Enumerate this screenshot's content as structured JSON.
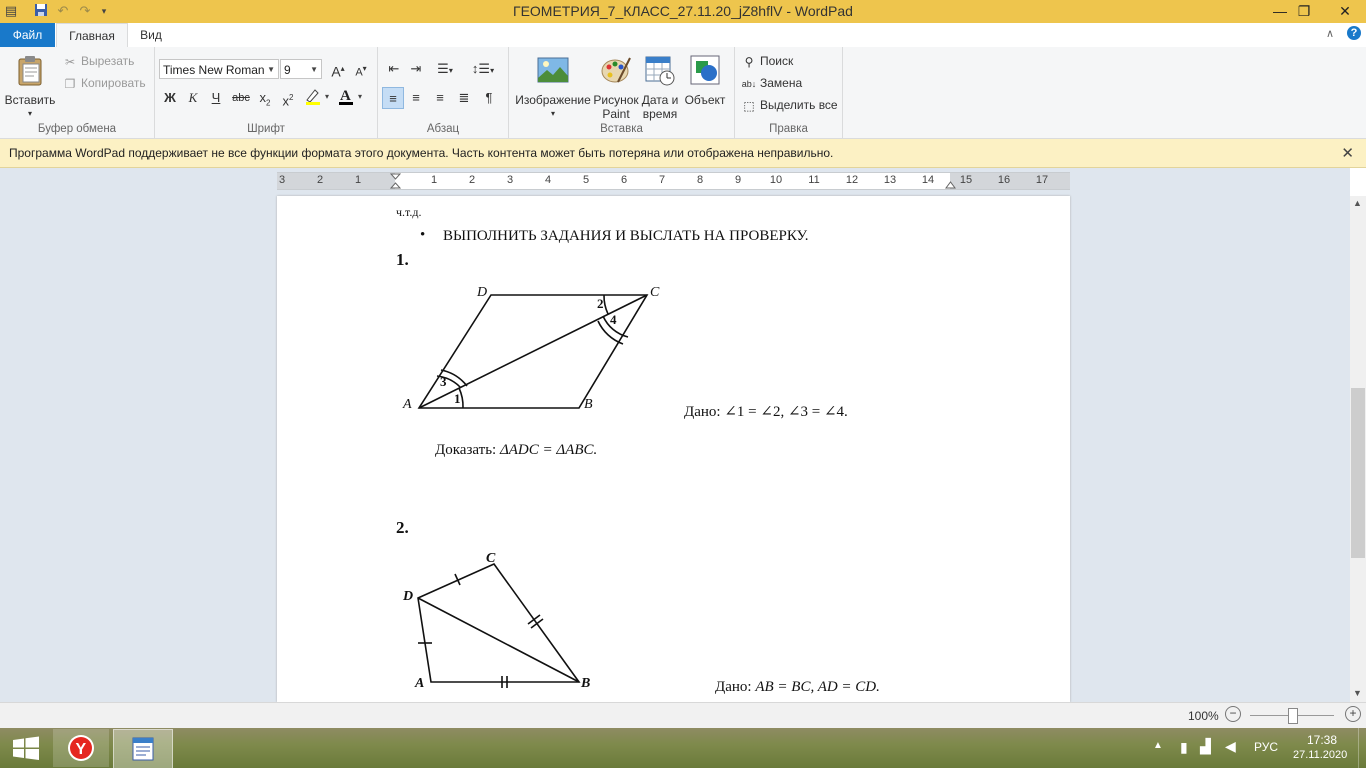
{
  "window": {
    "title": "ГЕОМЕТРИЯ_7_КЛАСС_27.11.20_jZ8hflV - WordPad"
  },
  "menu": {
    "file": "Файл",
    "tabs": [
      "Главная",
      "Вид"
    ]
  },
  "ribbon": {
    "clipboard": {
      "paste": "Вставить",
      "cut": "Вырезать",
      "copy": "Копировать",
      "group_label": "Буфер обмена"
    },
    "font": {
      "family": "Times New Roman",
      "size": "9",
      "bold": "Ж",
      "italic": "К",
      "underline": "Ч",
      "strike": "abc",
      "group_label": "Шрифт"
    },
    "paragraph": {
      "group_label": "Абзац"
    },
    "insert": {
      "picture": "Изображение",
      "paint_line1": "Рисунок",
      "paint_line2": "Paint",
      "datetime_line1": "Дата и",
      "datetime_line2": "время",
      "object": "Объект",
      "group_label": "Вставка"
    },
    "editing": {
      "find": "Поиск",
      "replace": "Замена",
      "select_all": "Выделить все",
      "group_label": "Правка"
    }
  },
  "infobar": {
    "message": "Программа WordPad поддерживает не все функции формата этого документа. Часть контента может быть потеряна или отображена неправильно."
  },
  "ruler": {
    "left_numbers": [
      "3",
      "2",
      "1"
    ],
    "right_numbers": [
      "1",
      "2",
      "3",
      "4",
      "5",
      "6",
      "7",
      "8",
      "9",
      "10",
      "11",
      "12",
      "13",
      "14",
      "15",
      "16",
      "17"
    ]
  },
  "document": {
    "chtd": "ч.т.д.",
    "bullet_task": "ВЫПОЛНИТЬ ЗАДАНИЯ И ВЫСЛАТЬ НА ПРОВЕРКУ.",
    "problem1": {
      "number": "1.",
      "labels": {
        "A": "A",
        "B": "B",
        "C": "C",
        "D": "D",
        "a1": "1",
        "a2": "2",
        "a3": "3",
        "a4": "4"
      },
      "given_prefix": "Дано:",
      "given": "∠1 = ∠2, ∠3 = ∠4.",
      "prove_prefix": "Доказать:",
      "prove": "ΔADC = ΔABC."
    },
    "problem2": {
      "number": "2.",
      "labels": {
        "A": "A",
        "B": "B",
        "C": "C",
        "D": "D"
      },
      "given_prefix": "Дано:",
      "given": "AB = BC, AD = CD."
    }
  },
  "statusbar": {
    "zoom": "100%"
  },
  "taskbar": {
    "language": "РУС",
    "time": "17:38",
    "date": "27.11.2020"
  },
  "colors": {
    "titlebar": "#eec54d",
    "file_tab": "#1979ca",
    "infobar": "#fcf1c4",
    "doc_background": "#dfe6ee"
  }
}
